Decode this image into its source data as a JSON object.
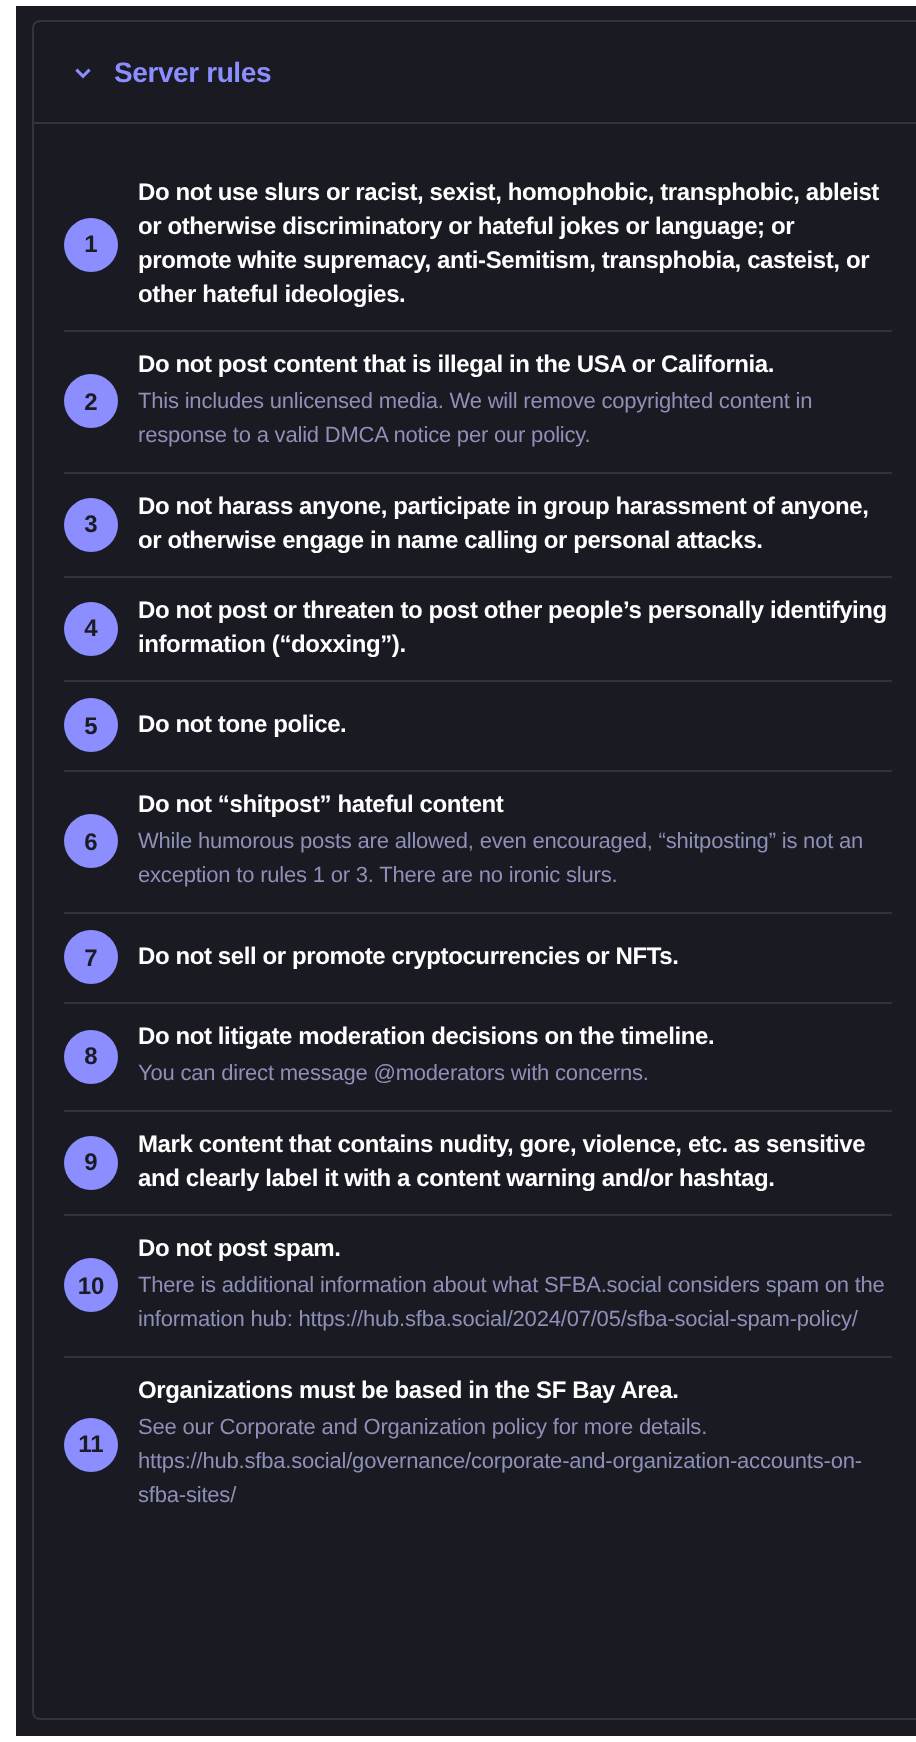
{
  "section": {
    "title": "Server rules",
    "expanded": true
  },
  "rules": [
    {
      "number": "1",
      "text": "Do not use slurs or racist, sexist, homophobic, transphobic, ableist or otherwise discriminatory or hateful jokes or language; or promote white supremacy, anti-Semitism, transphobia, casteist, or other hateful ideologies."
    },
    {
      "number": "2",
      "text": "Do not post content that is illegal in the USA or California.",
      "hint": "This includes unlicensed media. We will remove copyrighted content in response to a valid DMCA notice per our policy."
    },
    {
      "number": "3",
      "text": "Do not harass anyone, participate in group harassment of anyone, or otherwise engage in name calling or personal attacks."
    },
    {
      "number": "4",
      "text": "Do not post or threaten to post other people’s personally identifying information (“doxxing”)."
    },
    {
      "number": "5",
      "text": "Do not tone police."
    },
    {
      "number": "6",
      "text": "Do not “shitpost” hateful content",
      "hint": "While humorous posts are allowed, even encouraged, “shitposting” is not an exception to rules 1 or 3. There are no ironic slurs."
    },
    {
      "number": "7",
      "text": "Do not sell or promote cryptocurrencies or NFTs."
    },
    {
      "number": "8",
      "text": "Do not litigate moderation decisions on the timeline.",
      "hint": "You can direct message @moderators with concerns."
    },
    {
      "number": "9",
      "text": "Mark content that contains nudity, gore, violence, etc. as sensitive and clearly label it with a content warning and/or hashtag."
    },
    {
      "number": "10",
      "text": "Do not post spam.",
      "hint": "There is additional information about what SFBA.social considers spam on the information hub: https://hub.sfba.social/2024/07/05/sfba-social-spam-policy/"
    },
    {
      "number": "11",
      "text": "Organizations must be based in the SF Bay Area.",
      "hint": "See our Corporate and Organization policy for more details. https://hub.sfba.social/governance/corporate-and-organization-accounts-on-sfba-sites/"
    }
  ]
}
